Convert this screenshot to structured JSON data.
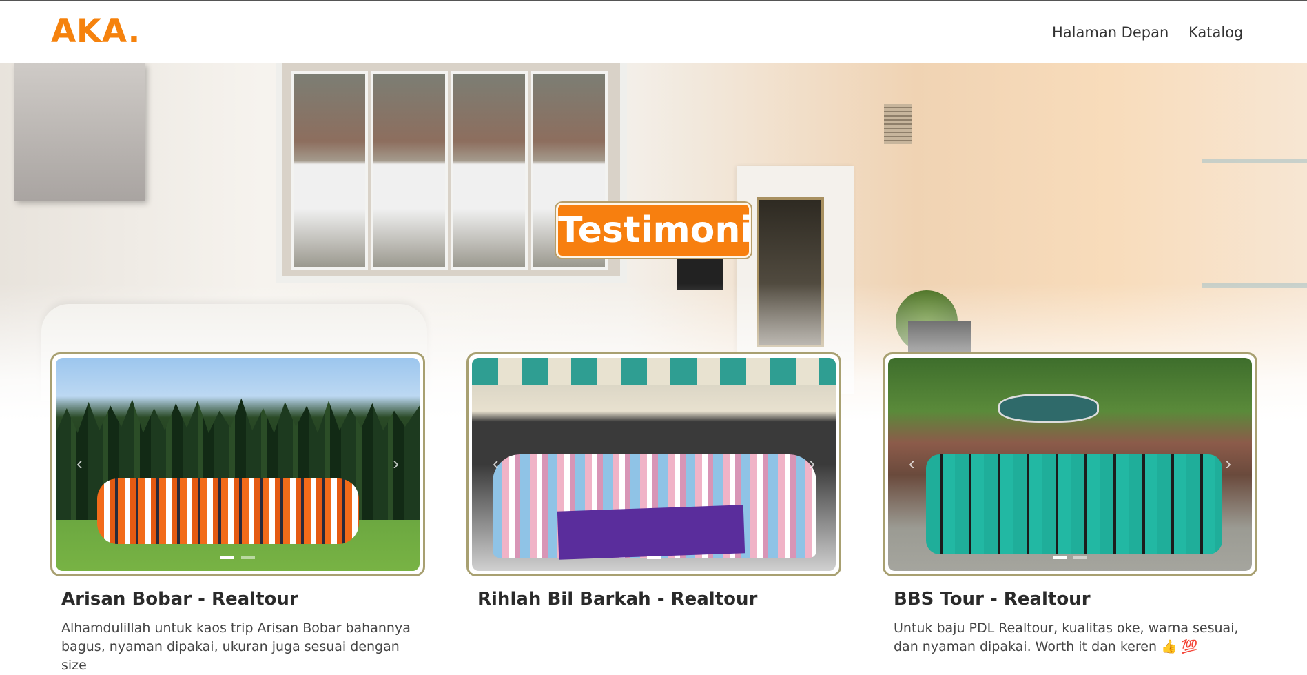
{
  "navbar": {
    "brand": "AKA.",
    "links": [
      {
        "label": "Halaman Depan"
      },
      {
        "label": "Katalog"
      }
    ]
  },
  "hero": {
    "title": "Testimoni"
  },
  "testimonials": [
    {
      "title": "Arisan Bobar - Realtour",
      "text": "Alhamdulillah untuk kaos trip Arisan Bobar bahannya bagus, nyaman dipakai, ukuran juga sesuai dengan size"
    },
    {
      "title": "Rihlah Bil Barkah - Realtour",
      "text": ""
    },
    {
      "title": "BBS Tour - Realtour",
      "text": "Untuk baju PDL Realtour, kualitas oke, warna sesuai, dan nyaman dipakai. Worth it dan keren 👍 💯"
    }
  ],
  "carousel": {
    "prev_icon": "‹",
    "next_icon": "›"
  },
  "colors": {
    "brand": "#f5820d",
    "hero_title_bg": "#f77f0f",
    "card_border": "#a8a071"
  }
}
